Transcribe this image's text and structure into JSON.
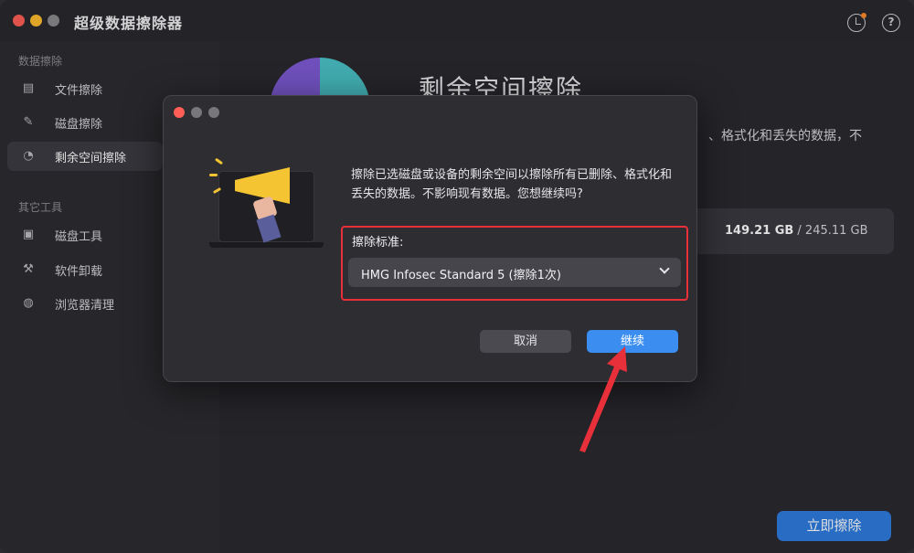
{
  "window": {
    "title": "超级数据擦除器"
  },
  "header_icons": {
    "history": "history-icon",
    "help": "help-icon"
  },
  "help_glyph": "?",
  "sidebar": {
    "section1": "数据擦除",
    "section2": "其它工具",
    "items": [
      {
        "label": "文件擦除",
        "icon": "file-shred-icon",
        "glyph": "▤"
      },
      {
        "label": "磁盘擦除",
        "icon": "disk-erase-icon",
        "glyph": "✎"
      },
      {
        "label": "剩余空间擦除",
        "icon": "pie-chart-icon",
        "glyph": "◔"
      },
      {
        "label": "磁盘工具",
        "icon": "disk-tool-icon",
        "glyph": "▣"
      },
      {
        "label": "软件卸载",
        "icon": "uninstall-icon",
        "glyph": "⚒"
      },
      {
        "label": "浏览器清理",
        "icon": "browser-clean-icon",
        "glyph": "◍"
      }
    ]
  },
  "main": {
    "title": "剩余空间擦除",
    "desc": "、格式化和丢失的数据，不",
    "storage_used": "149.21 GB",
    "storage_total": " / 245.11 GB",
    "wipe_button": "立即擦除"
  },
  "dialog": {
    "message": "擦除已选磁盘或设备的剩余空间以擦除所有已删除、格式化和丢失的数据。不影响现有数据。您想继续吗?",
    "standard_label": "擦除标准:",
    "standard_value": "HMG Infosec Standard 5 (擦除1次)",
    "cancel": "取消",
    "continue": "继续"
  },
  "colors": {
    "accent": "#3b8ef0",
    "highlight_box": "#e8303a",
    "background": "#2a2a2f"
  }
}
